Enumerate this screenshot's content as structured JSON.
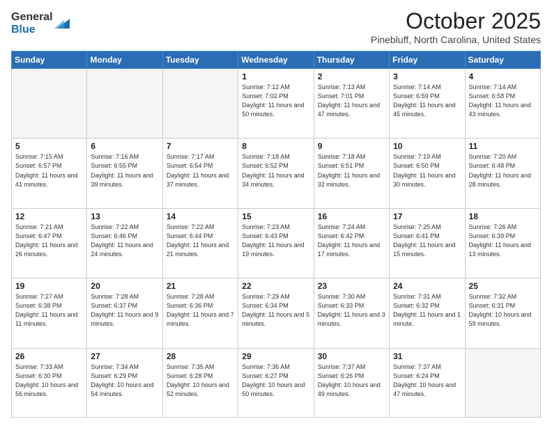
{
  "logo": {
    "general": "General",
    "blue": "Blue"
  },
  "header": {
    "month": "October 2025",
    "location": "Pinebluff, North Carolina, United States"
  },
  "weekdays": [
    "Sunday",
    "Monday",
    "Tuesday",
    "Wednesday",
    "Thursday",
    "Friday",
    "Saturday"
  ],
  "weeks": [
    [
      {
        "day": "",
        "info": ""
      },
      {
        "day": "",
        "info": ""
      },
      {
        "day": "",
        "info": ""
      },
      {
        "day": "1",
        "info": "Sunrise: 7:12 AM\nSunset: 7:02 PM\nDaylight: 11 hours\nand 50 minutes."
      },
      {
        "day": "2",
        "info": "Sunrise: 7:13 AM\nSunset: 7:01 PM\nDaylight: 11 hours\nand 47 minutes."
      },
      {
        "day": "3",
        "info": "Sunrise: 7:14 AM\nSunset: 6:59 PM\nDaylight: 11 hours\nand 45 minutes."
      },
      {
        "day": "4",
        "info": "Sunrise: 7:14 AM\nSunset: 6:58 PM\nDaylight: 11 hours\nand 43 minutes."
      }
    ],
    [
      {
        "day": "5",
        "info": "Sunrise: 7:15 AM\nSunset: 6:57 PM\nDaylight: 11 hours\nand 41 minutes."
      },
      {
        "day": "6",
        "info": "Sunrise: 7:16 AM\nSunset: 6:55 PM\nDaylight: 11 hours\nand 39 minutes."
      },
      {
        "day": "7",
        "info": "Sunrise: 7:17 AM\nSunset: 6:54 PM\nDaylight: 11 hours\nand 37 minutes."
      },
      {
        "day": "8",
        "info": "Sunrise: 7:18 AM\nSunset: 6:52 PM\nDaylight: 11 hours\nand 34 minutes."
      },
      {
        "day": "9",
        "info": "Sunrise: 7:18 AM\nSunset: 6:51 PM\nDaylight: 11 hours\nand 32 minutes."
      },
      {
        "day": "10",
        "info": "Sunrise: 7:19 AM\nSunset: 6:50 PM\nDaylight: 11 hours\nand 30 minutes."
      },
      {
        "day": "11",
        "info": "Sunrise: 7:20 AM\nSunset: 6:48 PM\nDaylight: 11 hours\nand 28 minutes."
      }
    ],
    [
      {
        "day": "12",
        "info": "Sunrise: 7:21 AM\nSunset: 6:47 PM\nDaylight: 11 hours\nand 26 minutes."
      },
      {
        "day": "13",
        "info": "Sunrise: 7:22 AM\nSunset: 6:46 PM\nDaylight: 11 hours\nand 24 minutes."
      },
      {
        "day": "14",
        "info": "Sunrise: 7:22 AM\nSunset: 6:44 PM\nDaylight: 11 hours\nand 21 minutes."
      },
      {
        "day": "15",
        "info": "Sunrise: 7:23 AM\nSunset: 6:43 PM\nDaylight: 11 hours\nand 19 minutes."
      },
      {
        "day": "16",
        "info": "Sunrise: 7:24 AM\nSunset: 6:42 PM\nDaylight: 11 hours\nand 17 minutes."
      },
      {
        "day": "17",
        "info": "Sunrise: 7:25 AM\nSunset: 6:41 PM\nDaylight: 11 hours\nand 15 minutes."
      },
      {
        "day": "18",
        "info": "Sunrise: 7:26 AM\nSunset: 6:39 PM\nDaylight: 11 hours\nand 13 minutes."
      }
    ],
    [
      {
        "day": "19",
        "info": "Sunrise: 7:27 AM\nSunset: 6:38 PM\nDaylight: 11 hours\nand 11 minutes."
      },
      {
        "day": "20",
        "info": "Sunrise: 7:28 AM\nSunset: 6:37 PM\nDaylight: 11 hours\nand 9 minutes."
      },
      {
        "day": "21",
        "info": "Sunrise: 7:28 AM\nSunset: 6:36 PM\nDaylight: 11 hours\nand 7 minutes."
      },
      {
        "day": "22",
        "info": "Sunrise: 7:29 AM\nSunset: 6:34 PM\nDaylight: 11 hours\nand 5 minutes."
      },
      {
        "day": "23",
        "info": "Sunrise: 7:30 AM\nSunset: 6:33 PM\nDaylight: 11 hours\nand 3 minutes."
      },
      {
        "day": "24",
        "info": "Sunrise: 7:31 AM\nSunset: 6:32 PM\nDaylight: 11 hours\nand 1 minute."
      },
      {
        "day": "25",
        "info": "Sunrise: 7:32 AM\nSunset: 6:31 PM\nDaylight: 10 hours\nand 59 minutes."
      }
    ],
    [
      {
        "day": "26",
        "info": "Sunrise: 7:33 AM\nSunset: 6:30 PM\nDaylight: 10 hours\nand 56 minutes."
      },
      {
        "day": "27",
        "info": "Sunrise: 7:34 AM\nSunset: 6:29 PM\nDaylight: 10 hours\nand 54 minutes."
      },
      {
        "day": "28",
        "info": "Sunrise: 7:35 AM\nSunset: 6:28 PM\nDaylight: 10 hours\nand 52 minutes."
      },
      {
        "day": "29",
        "info": "Sunrise: 7:36 AM\nSunset: 6:27 PM\nDaylight: 10 hours\nand 50 minutes."
      },
      {
        "day": "30",
        "info": "Sunrise: 7:37 AM\nSunset: 6:26 PM\nDaylight: 10 hours\nand 49 minutes."
      },
      {
        "day": "31",
        "info": "Sunrise: 7:37 AM\nSunset: 6:24 PM\nDaylight: 10 hours\nand 47 minutes."
      },
      {
        "day": "",
        "info": ""
      }
    ]
  ]
}
